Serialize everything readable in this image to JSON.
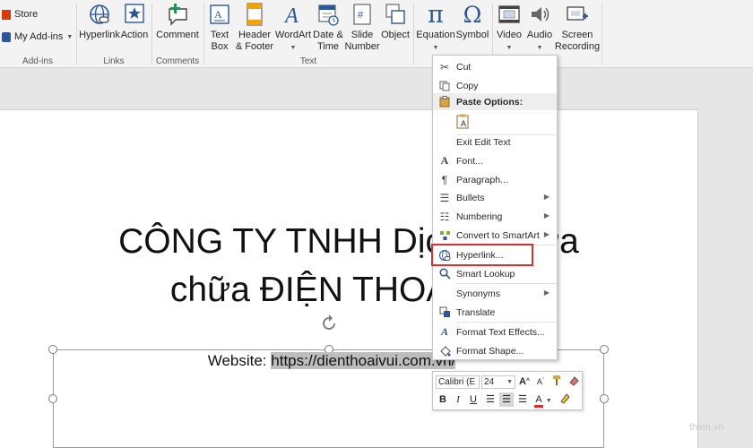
{
  "ribbon": {
    "addins": {
      "store_label": "Store",
      "myaddins_label": "My Add-ins",
      "group_label": "Add-ins"
    },
    "links": {
      "hyperlink_label": "Hyperlink",
      "action_label": "Action",
      "group_label": "Links"
    },
    "comments": {
      "comment_label": "Comment",
      "group_label": "Comments"
    },
    "text": {
      "textbox_line1": "Text",
      "textbox_line2": "Box",
      "header_line1": "Header",
      "header_line2": "& Footer",
      "wordart_label": "WordArt",
      "datetime_line1": "Date &",
      "datetime_line2": "Time",
      "slidenum_line1": "Slide",
      "slidenum_line2": "Number",
      "object_label": "Object",
      "group_label": "Text"
    },
    "symbols": {
      "equation_label": "Equation",
      "symbol_label": "Symbol"
    },
    "media": {
      "video_label": "Video",
      "audio_label": "Audio",
      "screen_line1": "Screen",
      "screen_line2": "Recording"
    }
  },
  "slide": {
    "title_line1": "CÔNG TY TNHH Dịch vụ sửa",
    "title_line2": "chữa ĐIỆN THOẠI VUI",
    "website_prefix": "Website: ",
    "website_url": "https://dienthoaivui.com.vn/"
  },
  "context_menu": {
    "cut": "Cut",
    "copy": "Copy",
    "paste_options": "Paste Options:",
    "exit_edit_text": "Exit Edit Text",
    "font": "Font...",
    "paragraph": "Paragraph...",
    "bullets": "Bullets",
    "numbering": "Numbering",
    "convert_smartart": "Convert to SmartArt",
    "hyperlink": "Hyperlink...",
    "smart_lookup": "Smart Lookup",
    "synonyms": "Synonyms",
    "translate": "Translate",
    "format_text_effects": "Format Text Effects...",
    "format_shape": "Format Shape..."
  },
  "mini_toolbar": {
    "font_name": "Calibri (E",
    "font_size": "24",
    "grow_label": "A",
    "shrink_label": "A",
    "bold": "B",
    "italic": "I",
    "underline": "U",
    "font_color_label": "A"
  },
  "watermark": "thien.vn",
  "colors": {
    "accent_blue": "#2b579a",
    "highlight_red": "#d9312f"
  }
}
